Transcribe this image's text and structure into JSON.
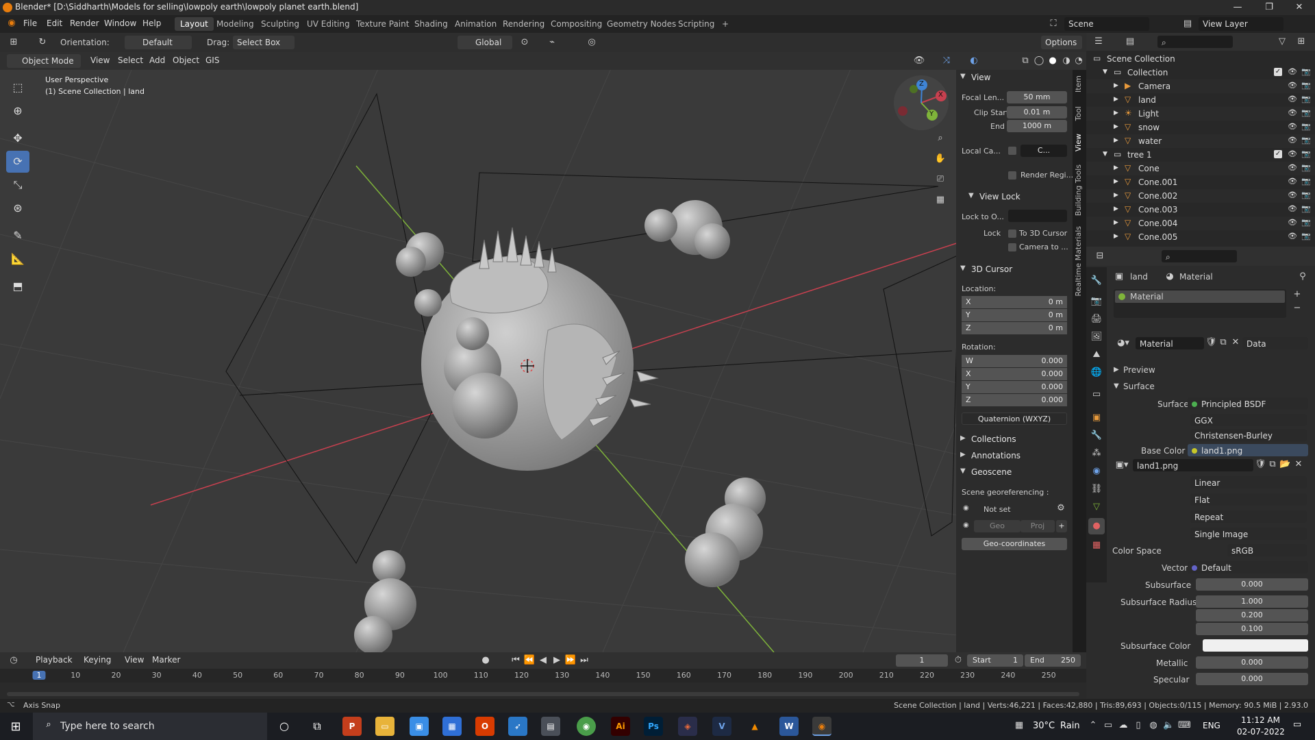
{
  "window": {
    "title": "Blender* [D:\\Siddharth\\Models for selling\\lowpoly earth\\lowpoly planet earth.blend]",
    "minimize": "—",
    "maximize": "❐",
    "close": "✕"
  },
  "menubar": {
    "items": [
      "File",
      "Edit",
      "Render",
      "Window",
      "Help"
    ],
    "workspaces": [
      "Layout",
      "Modeling",
      "Sculpting",
      "UV Editing",
      "Texture Paint",
      "Shading",
      "Animation",
      "Rendering",
      "Compositing",
      "Geometry Nodes",
      "Scripting"
    ],
    "active_workspace": "Layout",
    "add_tab": "+",
    "scene": "Scene",
    "view_layer": "View Layer"
  },
  "header": {
    "orientation_label": "Orientation:",
    "orientation_value": "Default",
    "drag_label": "Drag:",
    "drag_value": "Select Box",
    "transform_orientation": "Global",
    "options": "Options"
  },
  "viewport_header": {
    "mode": "Object Mode",
    "menus": [
      "View",
      "Select",
      "Add",
      "Object",
      "GIS"
    ]
  },
  "viewport": {
    "perspective": "User Perspective",
    "collection_info": "(1) Scene Collection | land",
    "gizmo_axes": [
      "X",
      "Y",
      "Z"
    ]
  },
  "npanel": {
    "tabs": [
      "Item",
      "Tool",
      "View",
      "Building Tools",
      "Realtime Materials"
    ],
    "view": {
      "header": "View",
      "focal_label": "Focal Len...",
      "focal_value": "50 mm",
      "clip_start_label": "Clip Start",
      "clip_start_value": "0.01 m",
      "clip_end_label": "End",
      "clip_end_value": "1000 m",
      "local_camera_label": "Local Ca...",
      "local_camera_value": "C...",
      "render_region": "Render Regi..."
    },
    "view_lock": {
      "header": "View Lock",
      "lock_to_label": "Lock to O...",
      "lock_label": "Lock",
      "to_3d_cursor": "To 3D Cursor",
      "camera_to": "Camera to ..."
    },
    "cursor": {
      "header": "3D Cursor",
      "location_label": "Location:",
      "loc": [
        {
          "axis": "X",
          "value": "0 m"
        },
        {
          "axis": "Y",
          "value": "0 m"
        },
        {
          "axis": "Z",
          "value": "0 m"
        }
      ],
      "rotation_label": "Rotation:",
      "rot": [
        {
          "axis": "W",
          "value": "0.000"
        },
        {
          "axis": "X",
          "value": "0.000"
        },
        {
          "axis": "Y",
          "value": "0.000"
        },
        {
          "axis": "Z",
          "value": "0.000"
        }
      ],
      "mode": "Quaternion (WXYZ)"
    },
    "collections": "Collections",
    "annotations": "Annotations",
    "geoscene": {
      "header": "Geoscene",
      "georef_label": "Scene georeferencing :",
      "not_set": "Not set",
      "geo": "Geo",
      "proj": "Proj",
      "geo_coordinates": "Geo-coordinates"
    }
  },
  "outliner": {
    "root": "Scene Collection",
    "rows": [
      {
        "name": "Collection",
        "indent": 1,
        "kind": "collection"
      },
      {
        "name": "Camera",
        "indent": 2,
        "kind": "camera"
      },
      {
        "name": "land",
        "indent": 2,
        "kind": "mesh"
      },
      {
        "name": "Light",
        "indent": 2,
        "kind": "light"
      },
      {
        "name": "snow",
        "indent": 2,
        "kind": "mesh"
      },
      {
        "name": "water",
        "indent": 2,
        "kind": "mesh"
      },
      {
        "name": "tree 1",
        "indent": 1,
        "kind": "collection"
      },
      {
        "name": "Cone",
        "indent": 2,
        "kind": "mesh"
      },
      {
        "name": "Cone.001",
        "indent": 2,
        "kind": "mesh"
      },
      {
        "name": "Cone.002",
        "indent": 2,
        "kind": "mesh"
      },
      {
        "name": "Cone.003",
        "indent": 2,
        "kind": "mesh"
      },
      {
        "name": "Cone.004",
        "indent": 2,
        "kind": "mesh"
      },
      {
        "name": "Cone.005",
        "indent": 2,
        "kind": "mesh"
      }
    ]
  },
  "properties": {
    "breadcrumb_object": "land",
    "breadcrumb_material": "Material",
    "slot": "Material",
    "material_name": "Material",
    "link": "Data",
    "preview": "Preview",
    "surface_header": "Surface",
    "surface_label": "Surface",
    "surface_value": "Principled BSDF",
    "distribution": "GGX",
    "subsurface_method": "Christensen-Burley",
    "base_color_label": "Base Color",
    "base_color_value": "land1.png",
    "image_name": "land1.png",
    "interpolation": "Linear",
    "projection": "Flat",
    "extension": "Repeat",
    "source": "Single Image",
    "color_space_label": "Color Space",
    "color_space_value": "sRGB",
    "vector_label": "Vector",
    "vector_value": "Default",
    "subsurface_label": "Subsurface",
    "subsurface_value": "0.000",
    "subsurface_radius_label": "Subsurface Radius",
    "subsurface_radius": [
      "1.000",
      "0.200",
      "0.100"
    ],
    "subsurface_color_label": "Subsurface Color",
    "metallic_label": "Metallic",
    "metallic_value": "0.000",
    "specular_label": "Specular",
    "specular_value": "0.000"
  },
  "timeline": {
    "menus": [
      "Playback",
      "Keying",
      "View",
      "Marker"
    ],
    "current_frame": "1",
    "start_label": "Start",
    "start_value": "1",
    "end_label": "End",
    "end_value": "250",
    "ruler": [
      "1",
      "10",
      "20",
      "30",
      "40",
      "50",
      "60",
      "70",
      "80",
      "90",
      "100",
      "110",
      "120",
      "130",
      "140",
      "150",
      "160",
      "170",
      "180",
      "190",
      "200",
      "210",
      "220",
      "230",
      "240",
      "250"
    ]
  },
  "statusbar": {
    "left": "Axis Snap",
    "right": "Scene Collection | land | Verts:46,221 | Faces:42,880 | Tris:89,693 | Objects:0/115 | Memory: 90.5 MiB | 2.93.0"
  },
  "taskbar": {
    "search_placeholder": "Type here to search",
    "weather_temp": "30°C",
    "weather_desc": "Rain",
    "lang": "ENG",
    "time": "11:12 AM",
    "date": "02-07-2022"
  },
  "colors": {
    "accent": "#4772b3",
    "x_axis": "#c8404f",
    "y_axis": "#7fb43a",
    "z_axis": "#3f84d6"
  }
}
